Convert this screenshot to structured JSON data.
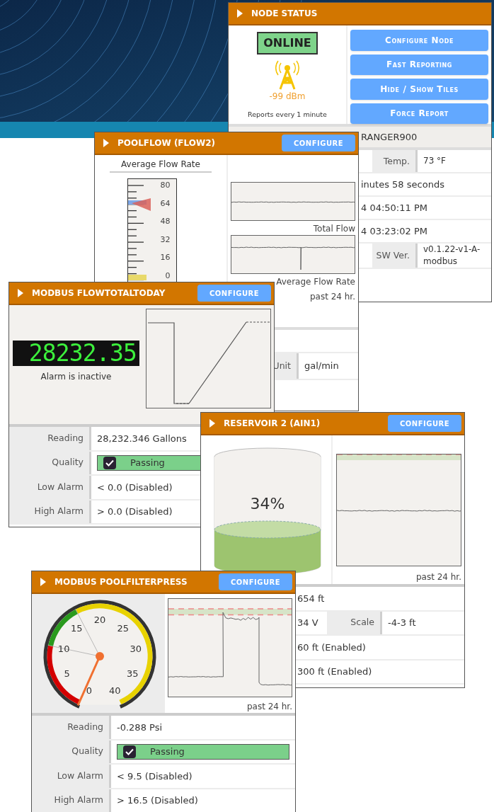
{
  "node_status": {
    "title": "NODE STATUS",
    "status": "ONLINE",
    "signal": "-99 dBm",
    "report_interval": "Reports every 1 minute",
    "buttons": [
      "Configure Node",
      "Fast Reporting",
      "Hide / Show Tiles",
      "Force Report"
    ],
    "rows": [
      {
        "kind": "title",
        "value": "RANGER900"
      },
      {
        "kind": "pair",
        "label": "Temp.",
        "value": "73 °F"
      },
      {
        "kind": "value",
        "value": "inutes 58 seconds"
      },
      {
        "kind": "value",
        "value": "4 04:50:11 PM"
      },
      {
        "kind": "value",
        "value": "4 03:23:02 PM"
      },
      {
        "kind": "pair",
        "label": "SW Ver.",
        "value": "v0.1.22-v1-A-modbus"
      }
    ]
  },
  "poolflow": {
    "title": "POOLFLOW (FLOW2)",
    "button": "CONFIGURE",
    "gauge_title": "Average Flow Rate",
    "scale_labels": [
      "80",
      "64",
      "48",
      "32",
      "16",
      "0"
    ],
    "charts": [
      "Total Flow",
      "Average Flow Rate"
    ],
    "footnote": "past 24 hr.",
    "rows": [
      {
        "kind": "pair",
        "label": "Unit",
        "value": "gal/min"
      }
    ]
  },
  "flow_total": {
    "title": "MODBUS FLOWTOTALTODAY",
    "button": "CONFIGURE",
    "display": "28232.35",
    "alarm_text": "Alarm is inactive",
    "rows": [
      {
        "kind": "text",
        "label": "Reading",
        "value": "28,232.346 Gallons"
      },
      {
        "kind": "status",
        "label": "Quality",
        "value": "Passing",
        "checked": true
      },
      {
        "kind": "text",
        "label": "Low Alarm",
        "value": "< 0.0 (Disabled)"
      },
      {
        "kind": "text",
        "label": "High Alarm",
        "value": "> 0.0 (Disabled)"
      }
    ]
  },
  "reservoir": {
    "title": "RESERVOIR 2 (AIN1)",
    "button": "CONFIGURE",
    "level": 0.34,
    "percent": "34%",
    "footnote": "past 24 hr.",
    "rows": [
      {
        "kind": "text",
        "value": "654 ft"
      },
      {
        "kind": "pair",
        "value": "34 V",
        "label2": "Scale",
        "value2": "-4-3 ft"
      },
      {
        "kind": "text",
        "value": "60 ft (Enabled)"
      },
      {
        "kind": "text",
        "value": "300 ft (Enabled)"
      }
    ]
  },
  "filter_press": {
    "title": "MODBUS POOLFILTERPRESS",
    "button": "CONFIGURE",
    "gauge_ticks": [
      "0",
      "5",
      "10",
      "15",
      "20",
      "25",
      "30",
      "35",
      "40"
    ],
    "footnote": "past 24 hr.",
    "rows": [
      {
        "kind": "text",
        "label": "Reading",
        "value": "-0.288 Psi"
      },
      {
        "kind": "status",
        "label": "Quality",
        "value": "Passing",
        "checked": true
      },
      {
        "kind": "text",
        "label": "Low Alarm",
        "value": "< 9.5 (Disabled)"
      },
      {
        "kind": "text",
        "label": "High Alarm",
        "value": "> 16.5 (Disabled)"
      }
    ]
  }
}
